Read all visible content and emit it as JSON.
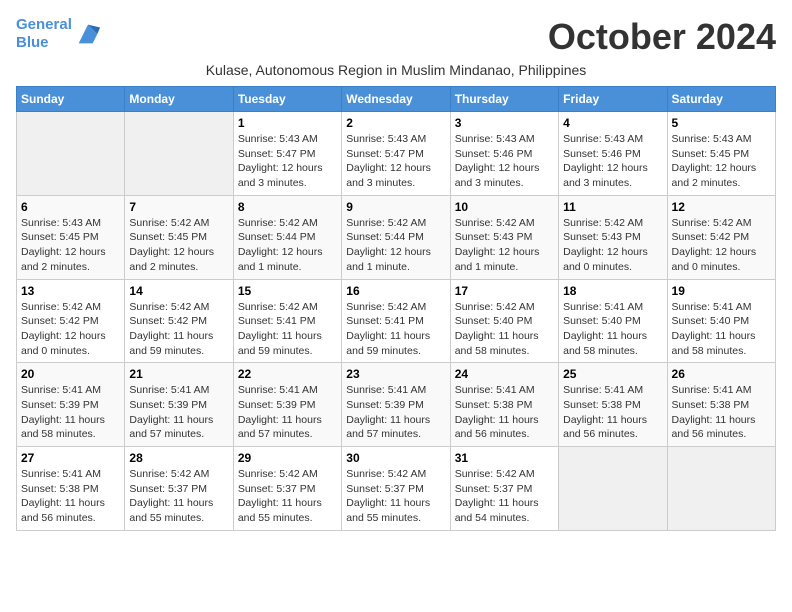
{
  "header": {
    "logo_line1": "General",
    "logo_line2": "Blue",
    "month": "October 2024",
    "subtitle": "Kulase, Autonomous Region in Muslim Mindanao, Philippines"
  },
  "weekdays": [
    "Sunday",
    "Monday",
    "Tuesday",
    "Wednesday",
    "Thursday",
    "Friday",
    "Saturday"
  ],
  "weeks": [
    [
      {
        "day": "",
        "info": ""
      },
      {
        "day": "",
        "info": ""
      },
      {
        "day": "1",
        "info": "Sunrise: 5:43 AM\nSunset: 5:47 PM\nDaylight: 12 hours and 3 minutes."
      },
      {
        "day": "2",
        "info": "Sunrise: 5:43 AM\nSunset: 5:47 PM\nDaylight: 12 hours and 3 minutes."
      },
      {
        "day": "3",
        "info": "Sunrise: 5:43 AM\nSunset: 5:46 PM\nDaylight: 12 hours and 3 minutes."
      },
      {
        "day": "4",
        "info": "Sunrise: 5:43 AM\nSunset: 5:46 PM\nDaylight: 12 hours and 3 minutes."
      },
      {
        "day": "5",
        "info": "Sunrise: 5:43 AM\nSunset: 5:45 PM\nDaylight: 12 hours and 2 minutes."
      }
    ],
    [
      {
        "day": "6",
        "info": "Sunrise: 5:43 AM\nSunset: 5:45 PM\nDaylight: 12 hours and 2 minutes."
      },
      {
        "day": "7",
        "info": "Sunrise: 5:42 AM\nSunset: 5:45 PM\nDaylight: 12 hours and 2 minutes."
      },
      {
        "day": "8",
        "info": "Sunrise: 5:42 AM\nSunset: 5:44 PM\nDaylight: 12 hours and 1 minute."
      },
      {
        "day": "9",
        "info": "Sunrise: 5:42 AM\nSunset: 5:44 PM\nDaylight: 12 hours and 1 minute."
      },
      {
        "day": "10",
        "info": "Sunrise: 5:42 AM\nSunset: 5:43 PM\nDaylight: 12 hours and 1 minute."
      },
      {
        "day": "11",
        "info": "Sunrise: 5:42 AM\nSunset: 5:43 PM\nDaylight: 12 hours and 0 minutes."
      },
      {
        "day": "12",
        "info": "Sunrise: 5:42 AM\nSunset: 5:42 PM\nDaylight: 12 hours and 0 minutes."
      }
    ],
    [
      {
        "day": "13",
        "info": "Sunrise: 5:42 AM\nSunset: 5:42 PM\nDaylight: 12 hours and 0 minutes."
      },
      {
        "day": "14",
        "info": "Sunrise: 5:42 AM\nSunset: 5:42 PM\nDaylight: 11 hours and 59 minutes."
      },
      {
        "day": "15",
        "info": "Sunrise: 5:42 AM\nSunset: 5:41 PM\nDaylight: 11 hours and 59 minutes."
      },
      {
        "day": "16",
        "info": "Sunrise: 5:42 AM\nSunset: 5:41 PM\nDaylight: 11 hours and 59 minutes."
      },
      {
        "day": "17",
        "info": "Sunrise: 5:42 AM\nSunset: 5:40 PM\nDaylight: 11 hours and 58 minutes."
      },
      {
        "day": "18",
        "info": "Sunrise: 5:41 AM\nSunset: 5:40 PM\nDaylight: 11 hours and 58 minutes."
      },
      {
        "day": "19",
        "info": "Sunrise: 5:41 AM\nSunset: 5:40 PM\nDaylight: 11 hours and 58 minutes."
      }
    ],
    [
      {
        "day": "20",
        "info": "Sunrise: 5:41 AM\nSunset: 5:39 PM\nDaylight: 11 hours and 58 minutes."
      },
      {
        "day": "21",
        "info": "Sunrise: 5:41 AM\nSunset: 5:39 PM\nDaylight: 11 hours and 57 minutes."
      },
      {
        "day": "22",
        "info": "Sunrise: 5:41 AM\nSunset: 5:39 PM\nDaylight: 11 hours and 57 minutes."
      },
      {
        "day": "23",
        "info": "Sunrise: 5:41 AM\nSunset: 5:39 PM\nDaylight: 11 hours and 57 minutes."
      },
      {
        "day": "24",
        "info": "Sunrise: 5:41 AM\nSunset: 5:38 PM\nDaylight: 11 hours and 56 minutes."
      },
      {
        "day": "25",
        "info": "Sunrise: 5:41 AM\nSunset: 5:38 PM\nDaylight: 11 hours and 56 minutes."
      },
      {
        "day": "26",
        "info": "Sunrise: 5:41 AM\nSunset: 5:38 PM\nDaylight: 11 hours and 56 minutes."
      }
    ],
    [
      {
        "day": "27",
        "info": "Sunrise: 5:41 AM\nSunset: 5:38 PM\nDaylight: 11 hours and 56 minutes."
      },
      {
        "day": "28",
        "info": "Sunrise: 5:42 AM\nSunset: 5:37 PM\nDaylight: 11 hours and 55 minutes."
      },
      {
        "day": "29",
        "info": "Sunrise: 5:42 AM\nSunset: 5:37 PM\nDaylight: 11 hours and 55 minutes."
      },
      {
        "day": "30",
        "info": "Sunrise: 5:42 AM\nSunset: 5:37 PM\nDaylight: 11 hours and 55 minutes."
      },
      {
        "day": "31",
        "info": "Sunrise: 5:42 AM\nSunset: 5:37 PM\nDaylight: 11 hours and 54 minutes."
      },
      {
        "day": "",
        "info": ""
      },
      {
        "day": "",
        "info": ""
      }
    ]
  ]
}
